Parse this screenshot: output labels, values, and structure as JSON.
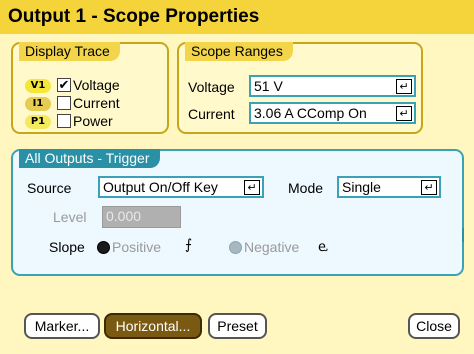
{
  "window": {
    "title": "Output 1 - Scope Properties"
  },
  "display_trace": {
    "title": "Display Trace",
    "items": [
      {
        "badge": "V1",
        "label": "Voltage",
        "checked": true
      },
      {
        "badge": "I1",
        "label": "Current",
        "checked": false
      },
      {
        "badge": "P1",
        "label": "Power",
        "checked": false
      }
    ],
    "check_mark": "✔"
  },
  "scope_ranges": {
    "title": "Scope Ranges",
    "voltage_label": "Voltage",
    "voltage_value": "51 V",
    "current_label": "Current",
    "current_value": "3.06 A CComp On"
  },
  "trigger": {
    "title": "All Outputs - Trigger",
    "source_label": "Source",
    "source_value": "Output On/Off Key",
    "mode_label": "Mode",
    "mode_value": "Single",
    "level_label": "Level",
    "level_value": "0.000",
    "slope_label": "Slope",
    "slope_positive": "Positive",
    "slope_negative": "Negative",
    "slope_selected": "Positive"
  },
  "enter_glyph": "↵",
  "rising_edge_glyph": "⨍",
  "falling_edge_glyph": "ⱸ",
  "buttons": {
    "marker": "Marker...",
    "horizontal": "Horizontal...",
    "preset": "Preset",
    "close": "Close"
  },
  "colors": {
    "title_bar": "#f5d33a",
    "panel": "#fff7bf",
    "group_yellow_border": "#c7a61a",
    "group_blue_border": "#3aa2b6",
    "active_button": "#7a5a12"
  }
}
